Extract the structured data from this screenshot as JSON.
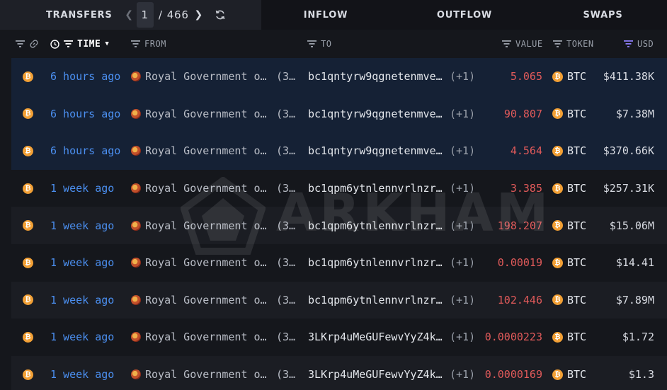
{
  "tabs": {
    "transfers": "TRANSFERS",
    "inflow": "INFLOW",
    "outflow": "OUTFLOW",
    "swaps": "SWAPS"
  },
  "pager": {
    "current": "1",
    "separator": "/",
    "total": "466"
  },
  "columns": {
    "time": "TIME",
    "from": "FROM",
    "to": "TO",
    "value": "VALUE",
    "token": "TOKEN",
    "usd": "USD"
  },
  "watermark": "ARKHAM",
  "colors": {
    "highlight_row": "#152135",
    "time_link": "#4b8ff0",
    "outflow_value": "#e05a5a",
    "btc_orange": "#f2a035",
    "usd_filter_active": "#8b7cf6"
  },
  "rows": [
    {
      "time": "6 hours ago",
      "from": "Royal Government o…",
      "from_count": "(3…",
      "to": "bc1qntyrw9qgnetenmve…",
      "to_count": "(+1)",
      "value": "5.065",
      "token": "BTC",
      "usd": "$411.38K"
    },
    {
      "time": "6 hours ago",
      "from": "Royal Government o…",
      "from_count": "(3…",
      "to": "bc1qntyrw9qgnetenmve…",
      "to_count": "(+1)",
      "value": "90.807",
      "token": "BTC",
      "usd": "$7.38M"
    },
    {
      "time": "6 hours ago",
      "from": "Royal Government o…",
      "from_count": "(3…",
      "to": "bc1qntyrw9qgnetenmve…",
      "to_count": "(+1)",
      "value": "4.564",
      "token": "BTC",
      "usd": "$370.66K"
    },
    {
      "time": "1 week ago",
      "from": "Royal Government o…",
      "from_count": "(3…",
      "to": "bc1qpm6ytnlennvrlnzr…",
      "to_count": "(+1)",
      "value": "3.385",
      "token": "BTC",
      "usd": "$257.31K"
    },
    {
      "time": "1 week ago",
      "from": "Royal Government o…",
      "from_count": "(3…",
      "to": "bc1qpm6ytnlennvrlnzr…",
      "to_count": "(+1)",
      "value": "198.207",
      "token": "BTC",
      "usd": "$15.06M"
    },
    {
      "time": "1 week ago",
      "from": "Royal Government o…",
      "from_count": "(3…",
      "to": "bc1qpm6ytnlennvrlnzr…",
      "to_count": "(+1)",
      "value": "0.00019",
      "token": "BTC",
      "usd": "$14.41"
    },
    {
      "time": "1 week ago",
      "from": "Royal Government o…",
      "from_count": "(3…",
      "to": "bc1qpm6ytnlennvrlnzr…",
      "to_count": "(+1)",
      "value": "102.446",
      "token": "BTC",
      "usd": "$7.89M"
    },
    {
      "time": "1 week ago",
      "from": "Royal Government o…",
      "from_count": "(3…",
      "to": "3LKrp4uMeGUFewvYyZ4k…",
      "to_count": "(+1)",
      "value": "0.0000223",
      "token": "BTC",
      "usd": "$1.72"
    },
    {
      "time": "1 week ago",
      "from": "Royal Government o…",
      "from_count": "(3…",
      "to": "3LKrp4uMeGUFewvYyZ4k…",
      "to_count": "(+1)",
      "value": "0.0000169",
      "token": "BTC",
      "usd": "$1.3"
    }
  ]
}
